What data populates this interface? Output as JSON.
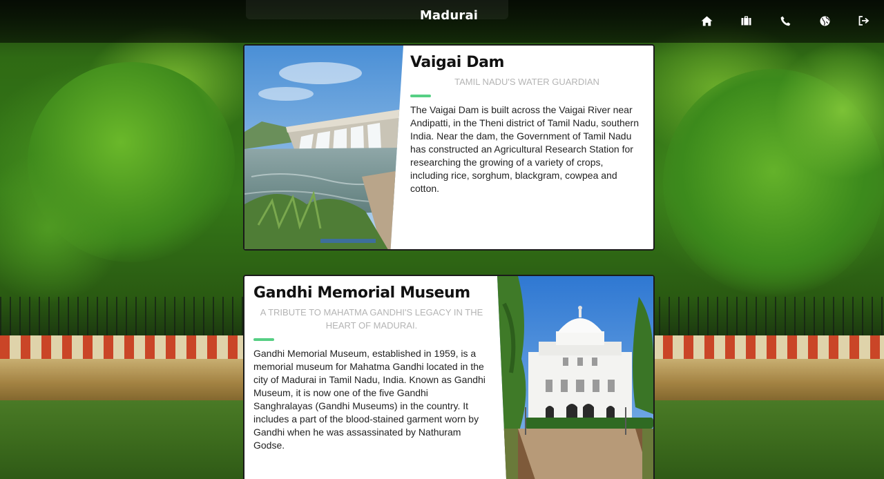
{
  "header": {
    "title": "Madurai",
    "nav": [
      {
        "icon": "home-icon"
      },
      {
        "icon": "briefcase-icon"
      },
      {
        "icon": "phone-icon"
      },
      {
        "icon": "globe-icon"
      },
      {
        "icon": "sign-out-icon"
      }
    ]
  },
  "cards": [
    {
      "title": "Vaigai Dam",
      "subtitle": "Tamil Nadu's Water Guardian",
      "body": "The Vaigai Dam is built across the Vaigai River near Andipatti, in the Theni district of Tamil Nadu, southern India. Near the dam, the Government of Tamil Nadu has constructed an Agricultural Research Station for researching the growing of a variety of crops, including rice, sorghum, blackgram, cowpea and cotton."
    },
    {
      "title": "Gandhi Memorial Museum",
      "subtitle": "A tribute to Mahatma Gandhi's legacy in the heart of Madurai.",
      "body": "Gandhi Memorial Museum, established in 1959, is a memorial museum for Mahatma Gandhi located in the city of Madurai in Tamil Nadu, India. Known as Gandhi Museum, it is now one of the five Gandhi Sanghralayas (Gandhi Museums) in the country. It includes a part of the blood-stained garment worn by Gandhi when he was assassinated by Nathuram Godse."
    }
  ],
  "colors": {
    "accent": "#56cf84",
    "header_bg": "#000000",
    "card_bg": "#ffffff"
  }
}
